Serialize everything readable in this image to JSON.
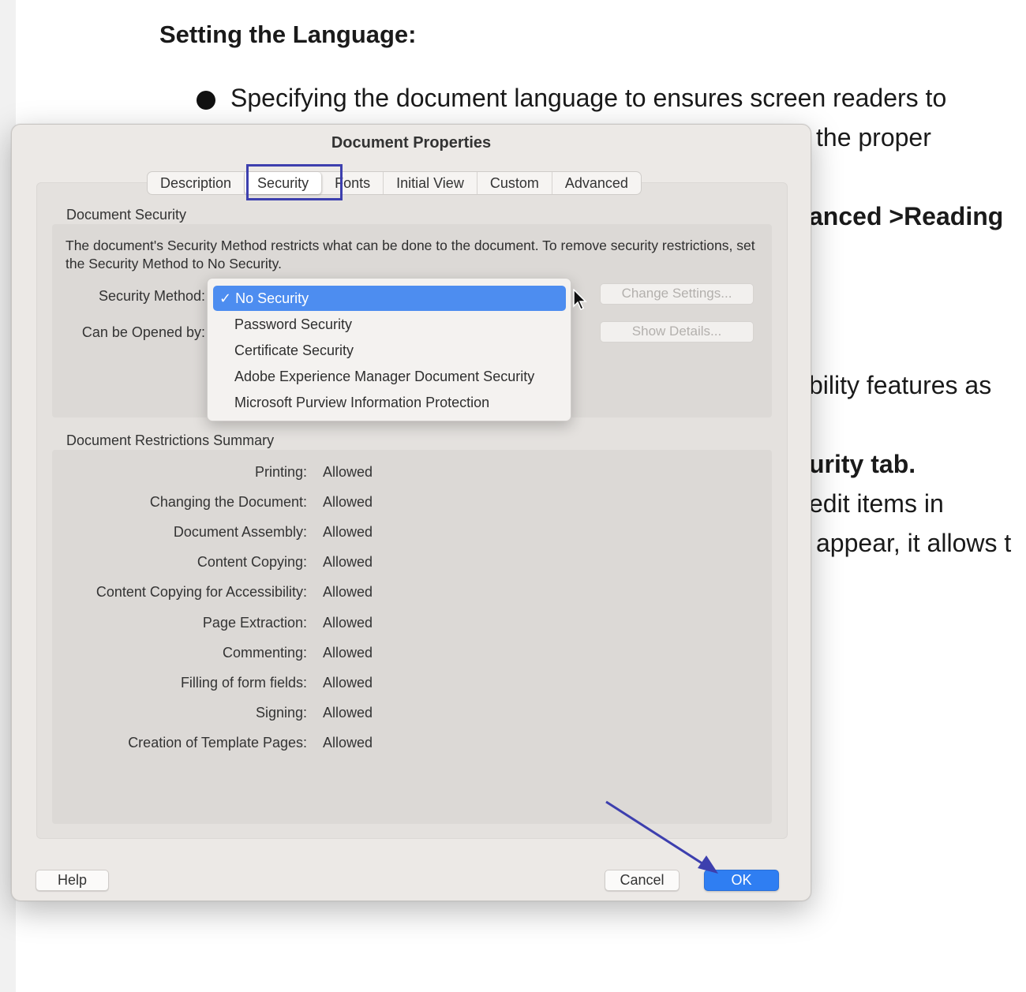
{
  "document": {
    "heading": "Setting the Language:",
    "bullet": "Specifying the document language to ensures screen readers to",
    "fragments": [
      "the proper",
      "anced >Reading",
      "bility features as",
      "urity tab.",
      "edit items in",
      "appear, it allows t"
    ]
  },
  "dialog": {
    "title": "Document Properties",
    "tabs": [
      "Description",
      "Security",
      "Fonts",
      "Initial View",
      "Custom",
      "Advanced"
    ],
    "active_tab": "Security",
    "document_security": {
      "section_label": "Document Security",
      "description": "The document's Security Method restricts what can be done to the document. To remove security restrictions, set the Security Method to No Security.",
      "method_label": "Security Method:",
      "opened_by_label": "Can be Opened by:",
      "change_settings": "Change Settings...",
      "show_details": "Show Details..."
    },
    "security_menu": {
      "selected": "✓ No Security",
      "options": [
        "Password Security",
        "Certificate Security",
        "Adobe Experience Manager Document Security",
        "Microsoft Purview Information Protection"
      ]
    },
    "restrictions": {
      "section_label": "Document Restrictions Summary",
      "rows": [
        {
          "label": "Printing:",
          "value": "Allowed"
        },
        {
          "label": "Changing the Document:",
          "value": "Allowed"
        },
        {
          "label": "Document Assembly:",
          "value": "Allowed"
        },
        {
          "label": "Content Copying:",
          "value": "Allowed"
        },
        {
          "label": "Content Copying for Accessibility:",
          "value": "Allowed"
        },
        {
          "label": "Page Extraction:",
          "value": "Allowed"
        },
        {
          "label": "Commenting:",
          "value": "Allowed"
        },
        {
          "label": "Filling of form fields:",
          "value": "Allowed"
        },
        {
          "label": "Signing:",
          "value": "Allowed"
        },
        {
          "label": "Creation of Template Pages:",
          "value": "Allowed"
        }
      ]
    },
    "buttons": {
      "help": "Help",
      "cancel": "Cancel",
      "ok": "OK"
    }
  },
  "colors": {
    "accent": "#2f7ef2",
    "annotation": "#3d3fae",
    "menu_selected": "#4d8df0"
  }
}
